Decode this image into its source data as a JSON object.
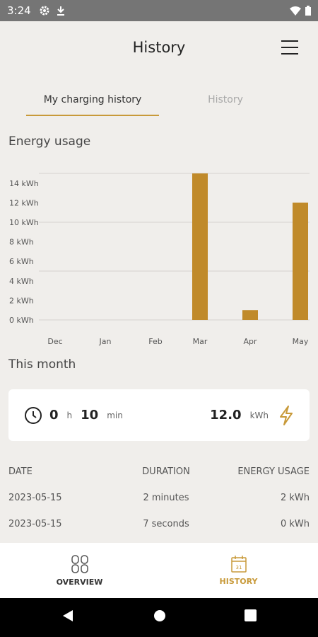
{
  "status_bar": {
    "time": "3:24"
  },
  "header": {
    "title": "History"
  },
  "tabs": [
    {
      "label": "My charging history",
      "active": true
    },
    {
      "label": "History",
      "active": false
    }
  ],
  "energy": {
    "title": "Energy usage"
  },
  "chart_data": {
    "type": "bar",
    "categories": [
      "Dec",
      "Jan",
      "Feb",
      "Mar",
      "Apr",
      "May"
    ],
    "values": [
      0,
      0,
      0,
      15,
      1,
      12
    ],
    "ytick_labels": [
      "0 kWh",
      "2 kWh",
      "4 kWh",
      "6 kWh",
      "8 kWh",
      "10 kWh",
      "12 kWh",
      "14 kWh"
    ],
    "ylim": [
      0,
      15
    ],
    "bar_color": "#c08a2a",
    "grid": true
  },
  "this_month": {
    "title": "This month",
    "hours": "0",
    "hours_unit": "h",
    "minutes": "10",
    "minutes_unit": "min",
    "energy": "12.0",
    "energy_unit": "kWh"
  },
  "table": {
    "headers": [
      "DATE",
      "DURATION",
      "ENERGY USAGE"
    ],
    "rows": [
      [
        "2023-05-15",
        "2 minutes",
        "2 kWh"
      ],
      [
        "2023-05-15",
        "7 seconds",
        "0 kWh"
      ]
    ]
  },
  "bottom_nav": {
    "overview": "OVERVIEW",
    "history": "HISTORY",
    "calendar_day": "31"
  },
  "colors": {
    "accent": "#c89a3a",
    "bar": "#c08a2a",
    "status_bar": "#757575"
  }
}
